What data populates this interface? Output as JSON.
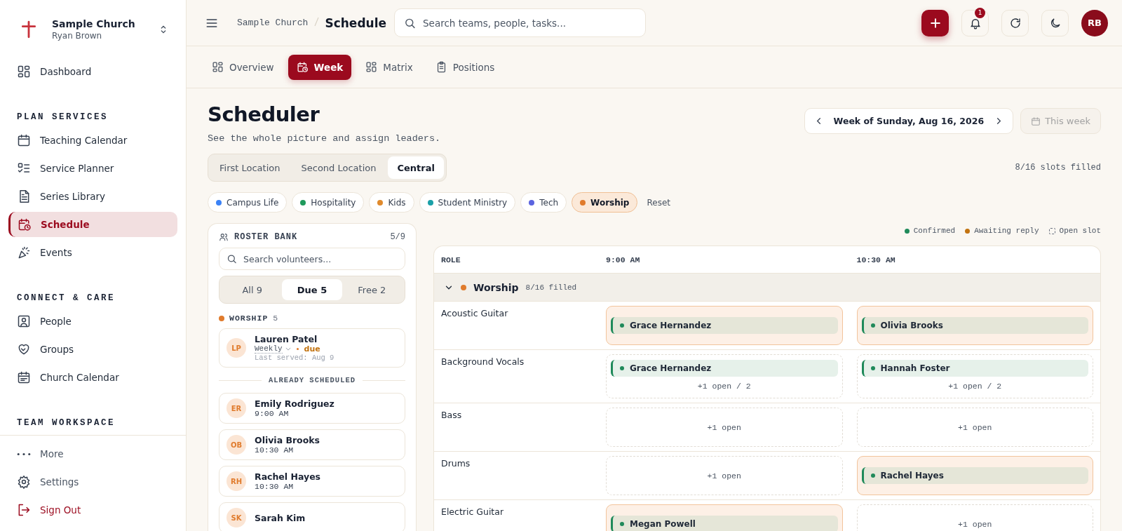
{
  "sidebar": {
    "org": {
      "name": "Sample Church",
      "user": "Ryan Brown"
    },
    "sections": [
      {
        "items": [
          {
            "label": "Dashboard",
            "selected": false
          }
        ]
      },
      {
        "heading": "PLAN SERVICES",
        "items": [
          {
            "label": "Teaching Calendar",
            "selected": false
          },
          {
            "label": "Service Planner",
            "selected": false
          },
          {
            "label": "Series Library",
            "selected": false
          },
          {
            "label": "Schedule",
            "selected": true
          },
          {
            "label": "Events",
            "selected": false
          }
        ]
      },
      {
        "heading": "CONNECT & CARE",
        "items": [
          {
            "label": "People",
            "selected": false
          },
          {
            "label": "Groups",
            "selected": false
          },
          {
            "label": "Church Calendar",
            "selected": false
          }
        ]
      },
      {
        "heading": "TEAM WORKSPACE"
      }
    ],
    "footer": [
      {
        "label": "More",
        "kind": "normal"
      },
      {
        "label": "Settings",
        "kind": "normal"
      },
      {
        "label": "Sign Out",
        "kind": "danger"
      }
    ]
  },
  "topbar": {
    "breadcrumb": [
      {
        "label": "Sample Church"
      },
      {
        "label": "Schedule"
      }
    ],
    "search": {
      "placeholder": "Search teams, people, tasks..."
    },
    "notifications": "1",
    "avatar": "RB"
  },
  "view_tabs": [
    {
      "label": "Overview",
      "selected": false
    },
    {
      "label": "Week",
      "selected": true
    },
    {
      "label": "Matrix",
      "selected": false
    },
    {
      "label": "Positions",
      "selected": false
    }
  ],
  "page": {
    "title": "Scheduler",
    "subtitle": "See the whole picture and assign leaders.",
    "week_label": "Week of Sunday, Aug 16, 2026",
    "this_week": {
      "label": "This week",
      "disabled": true
    },
    "locations": [
      {
        "label": "First Location",
        "selected": false
      },
      {
        "label": "Second Location",
        "selected": false
      },
      {
        "label": "Central",
        "selected": true
      }
    ],
    "slots_summary": "8/16 slots filled",
    "team_filters": [
      {
        "label": "Campus Life",
        "color": "#3b82f6",
        "selected": false
      },
      {
        "label": "Hospitality",
        "color": "#1f9a5c",
        "selected": false
      },
      {
        "label": "Kids",
        "color": "#e08a2c",
        "selected": false
      },
      {
        "label": "Student Ministry",
        "color": "#1aa0a8",
        "selected": false
      },
      {
        "label": "Tech",
        "color": "#5b64e0",
        "selected": false
      },
      {
        "label": "Worship",
        "color": "#e07b2c",
        "selected": true
      }
    ],
    "reset": "Reset",
    "legend": [
      {
        "label": "Confirmed",
        "kind": "confirmed"
      },
      {
        "label": "Awaiting reply",
        "kind": "awaiting"
      },
      {
        "label": "Open slot",
        "kind": "open"
      }
    ]
  },
  "roster": {
    "title": "ROSTER BANK",
    "count": "5/9",
    "search": {
      "placeholder": "Search volunteers..."
    },
    "segments": [
      {
        "label": "All 9",
        "selected": false
      },
      {
        "label": "Due 5",
        "selected": true
      },
      {
        "label": "Free 2",
        "selected": false
      }
    ],
    "group": {
      "name": "WORSHIP",
      "count": "5",
      "color": "#e07b2c"
    },
    "due": [
      {
        "initials": "LP",
        "name": "Lauren Patel",
        "frequency": "Weekly",
        "status": "due",
        "last_served": "Last served: Aug 9"
      }
    ],
    "divider": "ALREADY SCHEDULED",
    "scheduled": [
      {
        "initials": "ER",
        "name": "Emily Rodriguez",
        "time": "9:00 AM"
      },
      {
        "initials": "OB",
        "name": "Olivia Brooks",
        "time": "10:30 AM"
      },
      {
        "initials": "RH",
        "name": "Rachel Hayes",
        "time": "10:30 AM"
      },
      {
        "initials": "SK",
        "name": "Sarah Kim"
      }
    ]
  },
  "grid": {
    "columns": [
      "ROLE",
      "9:00 AM",
      "10:30 AM"
    ],
    "group": {
      "name": "Worship",
      "color": "#e07b2c",
      "summary": "8/16 filled",
      "expanded": true
    },
    "rows": [
      {
        "role": "Acoustic Guitar",
        "cells": [
          {
            "assignees": [
              {
                "name": "Grace Hernandez"
              }
            ]
          },
          {
            "assignees": [
              {
                "name": "Olivia Brooks"
              }
            ]
          }
        ]
      },
      {
        "role": "Background Vocals",
        "cells": [
          {
            "assignees": [
              {
                "name": "Grace Hernandez"
              }
            ],
            "open": "+1 open / 2"
          },
          {
            "assignees": [
              {
                "name": "Hannah Foster"
              }
            ],
            "open": "+1 open / 2"
          }
        ]
      },
      {
        "role": "Bass",
        "cells": [
          {
            "open": "+1 open"
          },
          {
            "open": "+1 open"
          }
        ]
      },
      {
        "role": "Drums",
        "cells": [
          {
            "open": "+1 open"
          },
          {
            "assignees": [
              {
                "name": "Rachel Hayes"
              }
            ]
          }
        ]
      },
      {
        "role": "Electric Guitar",
        "cells": [
          {
            "assignees": [
              {
                "name": "Megan Powell"
              }
            ]
          },
          {
            "open": "+1 open"
          }
        ]
      }
    ]
  }
}
